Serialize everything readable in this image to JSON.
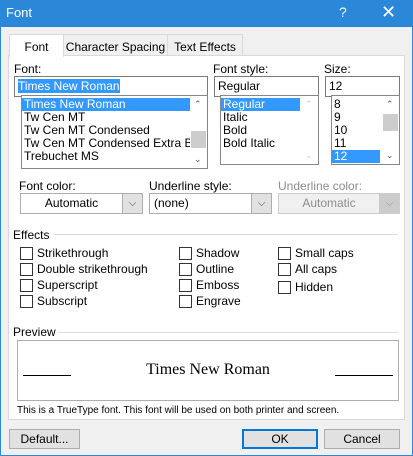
{
  "window": {
    "title": "Font",
    "help": "?",
    "close": "✕"
  },
  "tabs": [
    {
      "label": "Font"
    },
    {
      "label": "Character Spacing"
    },
    {
      "label": "Text Effects"
    }
  ],
  "font": {
    "label": "Font:",
    "value": "Times New Roman",
    "items": [
      "Times New Roman",
      "Tw Cen MT",
      "Tw Cen MT Condensed",
      "Tw Cen MT Condensed Extra Bold",
      "Trebuchet MS"
    ]
  },
  "style": {
    "label": "Font style:",
    "value": "Regular",
    "items": [
      "Regular",
      "Italic",
      "Bold",
      "Bold Italic"
    ]
  },
  "size": {
    "label": "Size:",
    "value": "12",
    "items": [
      "8",
      "9",
      "10",
      "11",
      "12"
    ]
  },
  "font_color": {
    "label": "Font color:",
    "value": "Automatic"
  },
  "underline_style": {
    "label": "Underline style:",
    "value": "(none)"
  },
  "underline_color": {
    "label": "Underline color:",
    "value": "Automatic",
    "disabled": true
  },
  "effects": {
    "label": "Effects",
    "items": [
      {
        "label": "Strikethrough",
        "checked": false
      },
      {
        "label": "Double strikethrough",
        "checked": false
      },
      {
        "label": "Superscript",
        "checked": false
      },
      {
        "label": "Subscript",
        "checked": false
      },
      {
        "label": "Shadow",
        "checked": false
      },
      {
        "label": "Outline",
        "checked": false
      },
      {
        "label": "Emboss",
        "checked": false
      },
      {
        "label": "Engrave",
        "checked": false
      },
      {
        "label": "Small caps",
        "checked": false
      },
      {
        "label": "All caps",
        "checked": false
      },
      {
        "label": "Hidden",
        "checked": false
      }
    ]
  },
  "preview": {
    "label": "Preview",
    "text": "Times New Roman",
    "note": "This is a TrueType font. This font will be used on both printer and screen."
  },
  "buttons": {
    "default": "Default...",
    "ok": "OK",
    "cancel": "Cancel"
  },
  "colors": {
    "titlebar": "#2b88d8",
    "selection": "#3399ff"
  }
}
